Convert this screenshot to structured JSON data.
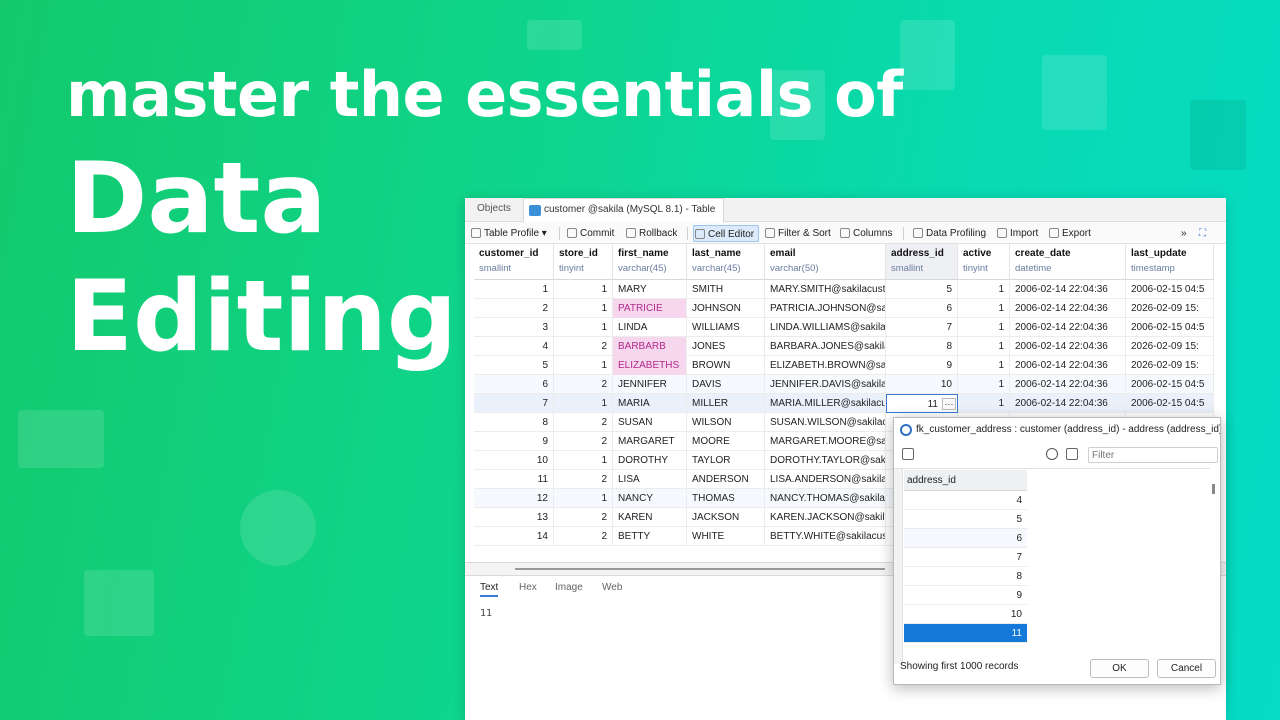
{
  "hero": {
    "subtitle": "master the essentials of",
    "title_line1": "Data",
    "title_line2": "Editing"
  },
  "window": {
    "tabs": [
      "Objects",
      "customer @sakila (MySQL 8.1) - Table"
    ],
    "toolbar": {
      "table_profile": "Table Profile",
      "commit": "Commit",
      "rollback": "Rollback",
      "cell_editor": "Cell Editor",
      "filter_sort": "Filter & Sort",
      "columns": "Columns",
      "data_profiling": "Data Profiling",
      "import": "Import",
      "export": "Export"
    },
    "columns": [
      {
        "name": "customer_id",
        "type": "smallint"
      },
      {
        "name": "store_id",
        "type": "tinyint"
      },
      {
        "name": "first_name",
        "type": "varchar(45)"
      },
      {
        "name": "last_name",
        "type": "varchar(45)"
      },
      {
        "name": "email",
        "type": "varchar(50)"
      },
      {
        "name": "address_id",
        "type": "smallint"
      },
      {
        "name": "active",
        "type": "tinyint"
      },
      {
        "name": "create_date",
        "type": "datetime"
      },
      {
        "name": "last_update",
        "type": "timestamp"
      }
    ],
    "rows": [
      [
        "1",
        "1",
        "MARY",
        "SMITH",
        "MARY.SMITH@sakilacusto",
        "5",
        "1",
        "2006-02-14 22:04:36",
        "2006-02-15 04:5"
      ],
      [
        "2",
        "1",
        "PATRICIE",
        "JOHNSON",
        "PATRICIA.JOHNSON@saki",
        "6",
        "1",
        "2006-02-14 22:04:36",
        "2026-02-09 15:"
      ],
      [
        "3",
        "1",
        "LINDA",
        "WILLIAMS",
        "LINDA.WILLIAMS@sakilac",
        "7",
        "1",
        "2006-02-14 22:04:36",
        "2006-02-15 04:5"
      ],
      [
        "4",
        "2",
        "BARBARB",
        "JONES",
        "BARBARA.JONES@sakilac",
        "8",
        "1",
        "2006-02-14 22:04:36",
        "2026-02-09 15:"
      ],
      [
        "5",
        "1",
        "ELIZABETHS",
        "BROWN",
        "ELIZABETH.BROWN@saki",
        "9",
        "1",
        "2006-02-14 22:04:36",
        "2026-02-09 15:"
      ],
      [
        "6",
        "2",
        "JENNIFER",
        "DAVIS",
        "JENNIFER.DAVIS@sakilacu",
        "10",
        "1",
        "2006-02-14 22:04:36",
        "2006-02-15 04:5"
      ],
      [
        "7",
        "1",
        "MARIA",
        "MILLER",
        "MARIA.MILLER@sakilacus",
        "11",
        "1",
        "2006-02-14 22:04:36",
        "2006-02-15 04:5"
      ],
      [
        "8",
        "2",
        "SUSAN",
        "WILSON",
        "SUSAN.WILSON@sakilacu",
        "",
        "",
        "",
        ""
      ],
      [
        "9",
        "2",
        "MARGARET",
        "MOORE",
        "MARGARET.MOORE@saki",
        "",
        "",
        "",
        ""
      ],
      [
        "10",
        "1",
        "DOROTHY",
        "TAYLOR",
        "DOROTHY.TAYLOR@sakila",
        "",
        "",
        "",
        ""
      ],
      [
        "11",
        "2",
        "LISA",
        "ANDERSON",
        "LISA.ANDERSON@sakilac",
        "",
        "",
        "",
        ""
      ],
      [
        "12",
        "1",
        "NANCY",
        "THOMAS",
        "NANCY.THOMAS@sakilac",
        "",
        "",
        "",
        ""
      ],
      [
        "13",
        "2",
        "KAREN",
        "JACKSON",
        "KAREN.JACKSON@sakilac",
        "",
        "",
        "",
        ""
      ],
      [
        "14",
        "2",
        "BETTY",
        "WHITE",
        "BETTY.WHITE@sakilacust",
        "",
        "",
        "",
        ""
      ]
    ],
    "highlight_cells": [
      [
        1,
        2
      ],
      [
        3,
        2
      ],
      [
        4,
        2
      ]
    ],
    "viewer_tabs": [
      "Text",
      "Hex",
      "Image",
      "Web"
    ],
    "viewer_value": "11"
  },
  "popup": {
    "title": "fk_customer_address : customer (address_id) - address (address_id)",
    "filter_placeholder": "Filter",
    "column": "address_id",
    "values": [
      "4",
      "5",
      "6",
      "7",
      "8",
      "9",
      "10",
      "11"
    ],
    "selected_value": "11",
    "status": "Showing first 1000 records",
    "ok": "OK",
    "cancel": "Cancel"
  },
  "colors": {
    "background_start": "#13c96c",
    "background_end": "#06dcc6",
    "selection": "#1479d8",
    "modified_cell": "#f7d7ee"
  }
}
